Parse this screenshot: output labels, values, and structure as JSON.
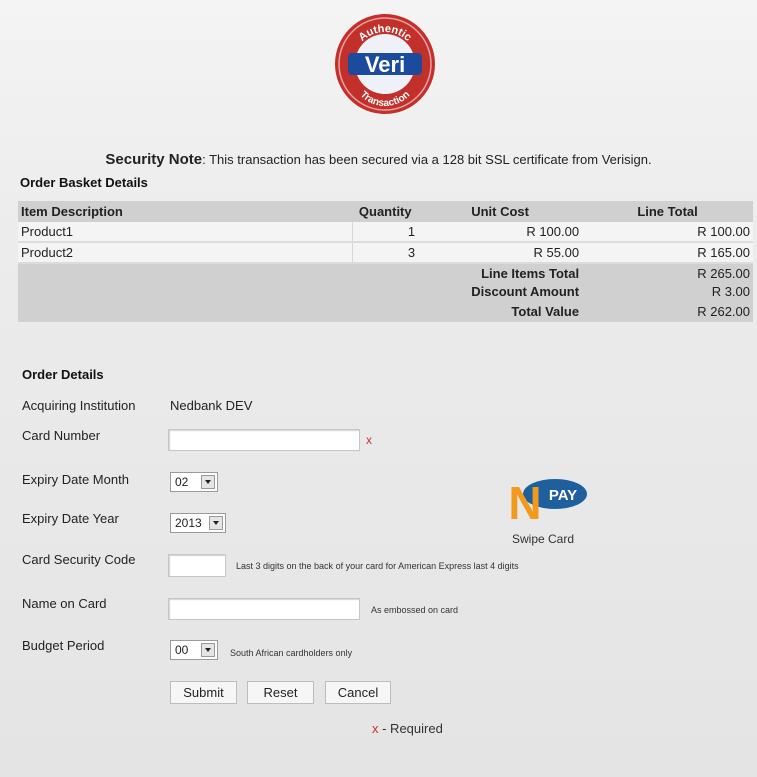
{
  "logo": {
    "top_text": "Authentic",
    "brand_text": "Veri",
    "bottom_text": "Transaction"
  },
  "security": {
    "label": "Security Note",
    "text": ": This transaction has been secured via a 128 bit SSL certificate from Verisign."
  },
  "basket": {
    "title": "Order Basket Details",
    "headers": {
      "description": "Item Description",
      "quantity": "Quantity",
      "unit_cost": "Unit Cost",
      "line_total": "Line Total"
    },
    "items": [
      {
        "description": "Product1",
        "quantity": "1",
        "unit_cost": "R 100.00",
        "line_total": "R 100.00"
      },
      {
        "description": "Product2",
        "quantity": "3",
        "unit_cost": "R 55.00",
        "line_total": "R 165.00"
      }
    ],
    "totals": [
      {
        "label": "Line Items Total",
        "value": "R 265.00"
      },
      {
        "label": "Discount Amount",
        "value": "R 3.00"
      },
      {
        "label": "Total Value",
        "value": "R 262.00"
      }
    ]
  },
  "order": {
    "title": "Order Details",
    "acquiring_label": "Acquiring Institution",
    "acquiring_value": "Nedbank DEV",
    "card_number_label": "Card Number",
    "card_number_value": "",
    "required_mark": "x",
    "expiry_month_label": "Expiry Date Month",
    "expiry_month_value": "02",
    "expiry_year_label": "Expiry Date Year",
    "expiry_year_value": "2013",
    "csc_label": "Card Security Code",
    "csc_value": "",
    "csc_hint": "Last 3 digits on the back of your card for American Express last 4 digits",
    "name_label": "Name on Card",
    "name_value": "",
    "name_hint": "As embossed on card",
    "budget_label": "Budget Period",
    "budget_value": "00",
    "budget_hint": "South African cardholders only"
  },
  "npay": {
    "letter": "N",
    "pay_text": "PAY",
    "caption": "Swipe Card"
  },
  "buttons": {
    "submit": "Submit",
    "reset": "Reset",
    "cancel": "Cancel"
  },
  "required_note": {
    "mark": "x",
    "text": " - Required"
  },
  "colors": {
    "logo_red": "#c2302c",
    "logo_blue": "#1c4a9c",
    "required_red": "#d03030",
    "npay_orange": "#f29a1c",
    "npay_blue": "#1e5f9e",
    "header_gray": "#d0d0d0"
  }
}
